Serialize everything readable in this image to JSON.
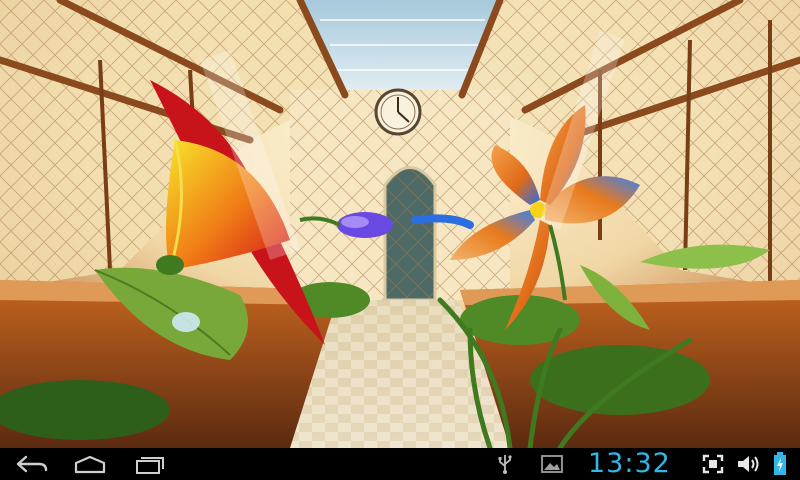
{
  "system_bar": {
    "time": "13:32",
    "accent_color": "#33b5e5",
    "icon_color": "#cfcfcf"
  },
  "nav": {
    "icons": [
      "back-icon",
      "home-icon",
      "recent-apps-icon"
    ]
  },
  "status_icons": [
    "usb-icon",
    "screenshot-image-icon",
    "fullscreen-icon",
    "volume-icon",
    "battery-charging-icon"
  ],
  "wallpaper": {
    "scene": "live-wallpaper-greenhouse",
    "colors": {
      "glass": "#f3e2b8",
      "frame": "#8a4a1e",
      "sky": "#b9d6e6",
      "floor": "#e8dcc0",
      "red_flower": "#d8161b",
      "yellow_flower": "#f7d21a",
      "blue_petal": "#2a6ee0",
      "orange_petal": "#ef7a1a",
      "leaf": "#6fa22c"
    }
  }
}
